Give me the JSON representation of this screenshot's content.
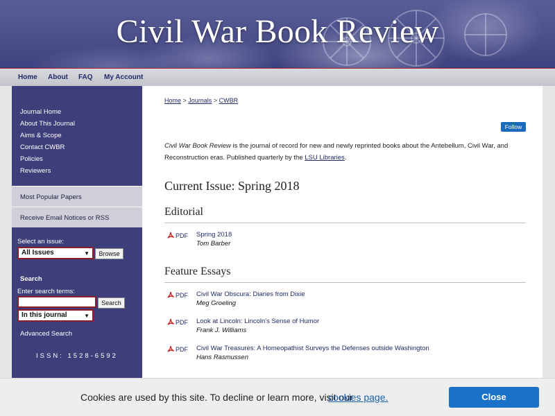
{
  "site": {
    "title": "Civil War Book Review"
  },
  "topnav": {
    "items": [
      "Home",
      "About",
      "FAQ",
      "My Account"
    ]
  },
  "sidebar": {
    "links": [
      "Journal Home",
      "About This Journal",
      "Aims & Scope",
      "Contact CWBR",
      "Policies",
      "Reviewers"
    ],
    "most_popular": "Most Popular Papers",
    "email_notices": "Receive Email Notices or RSS",
    "select_issue_label": "Select an issue:",
    "issue_select_value": "All Issues",
    "browse_button": "Browse",
    "search_heading": "Search",
    "search_terms_label": "Enter search terms:",
    "search_input_value": "",
    "search_button": "Search",
    "scope_select_value": "In this journal",
    "advanced_search": "Advanced Search",
    "issn": "ISSN: 1528-6592"
  },
  "breadcrumb": {
    "home": "Home",
    "sep1": " > ",
    "journals": "Journals",
    "sep2": " > ",
    "current": "CWBR"
  },
  "follow_button": "Follow",
  "intro": {
    "journal_name": "Civil War Book Review",
    "text": " is the journal of record for new and newly reprinted books about the Antebellum, Civil War, and Reconstruction eras. Published quarterly by the ",
    "link": "LSU Libraries",
    "end": "."
  },
  "current_issue": "Current Issue: Spring 2018",
  "sections": [
    {
      "heading": "Editorial",
      "articles": [
        {
          "pdf": "PDF",
          "title": "Spring 2018",
          "author": "Tom Barber"
        }
      ]
    },
    {
      "heading": "Feature Essays",
      "articles": [
        {
          "pdf": "PDF",
          "title": "Civil War Obscura: Diaries from Dixie",
          "author": "Meg Groeling"
        },
        {
          "pdf": "PDF",
          "title": "Look at Lincoln: Lincoln's Sense of Humor",
          "author": "Frank J. Williams"
        },
        {
          "pdf": "PDF",
          "title": "Civil War Treasures: A Homeopathist Surveys the Defenses outside Washington",
          "author": "Hans Rasmussen"
        }
      ]
    }
  ],
  "cookie": {
    "message": "Cookies are used by this site. To decline or learn more, visit our",
    "link": "cookies page.",
    "close": "Close"
  },
  "icons": {
    "pdf": "pdf-icon",
    "caret": "caret-down-icon"
  },
  "colors": {
    "sidebar": "#3e3f7a",
    "accent_red": "#8b1e2a",
    "follow_blue": "#1a6bbd",
    "close_blue": "#1a72c8"
  }
}
